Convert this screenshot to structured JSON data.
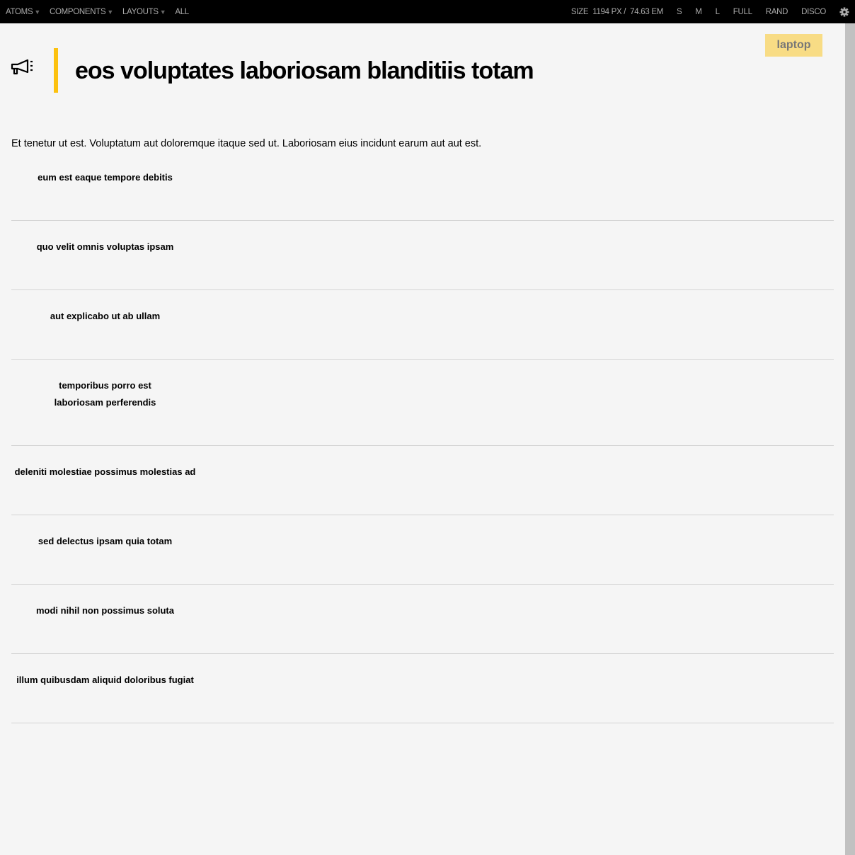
{
  "topbar": {
    "nav": [
      "ATOMS",
      "COMPONENTS",
      "LAYOUTS",
      "ALL"
    ],
    "size_label": "SIZE",
    "size_px": "1194 PX /",
    "size_em": "74.63 EM",
    "buttons": [
      "S",
      "M",
      "L",
      "FULL",
      "RAND",
      "DISCO"
    ]
  },
  "badge": "laptop",
  "title": "eos voluptates laboriosam blanditiis totam",
  "lead": "Et tenetur ut est. Voluptatum aut doloremque itaque sed ut. Laboriosam eius incidunt earum aut aut est.",
  "items": [
    "eum est eaque tempore debitis",
    "quo velit omnis voluptas ipsam",
    "aut explicabo ut ab ullam",
    "temporibus porro est laboriosam perferendis",
    "deleniti molestiae possimus molestias ad",
    "sed delectus ipsam quia totam",
    "modi nihil non possimus soluta",
    "illum quibusdam aliquid doloribus fugiat"
  ],
  "colors": {
    "accent": "#fcc10f",
    "badge": "#f8dc85"
  }
}
